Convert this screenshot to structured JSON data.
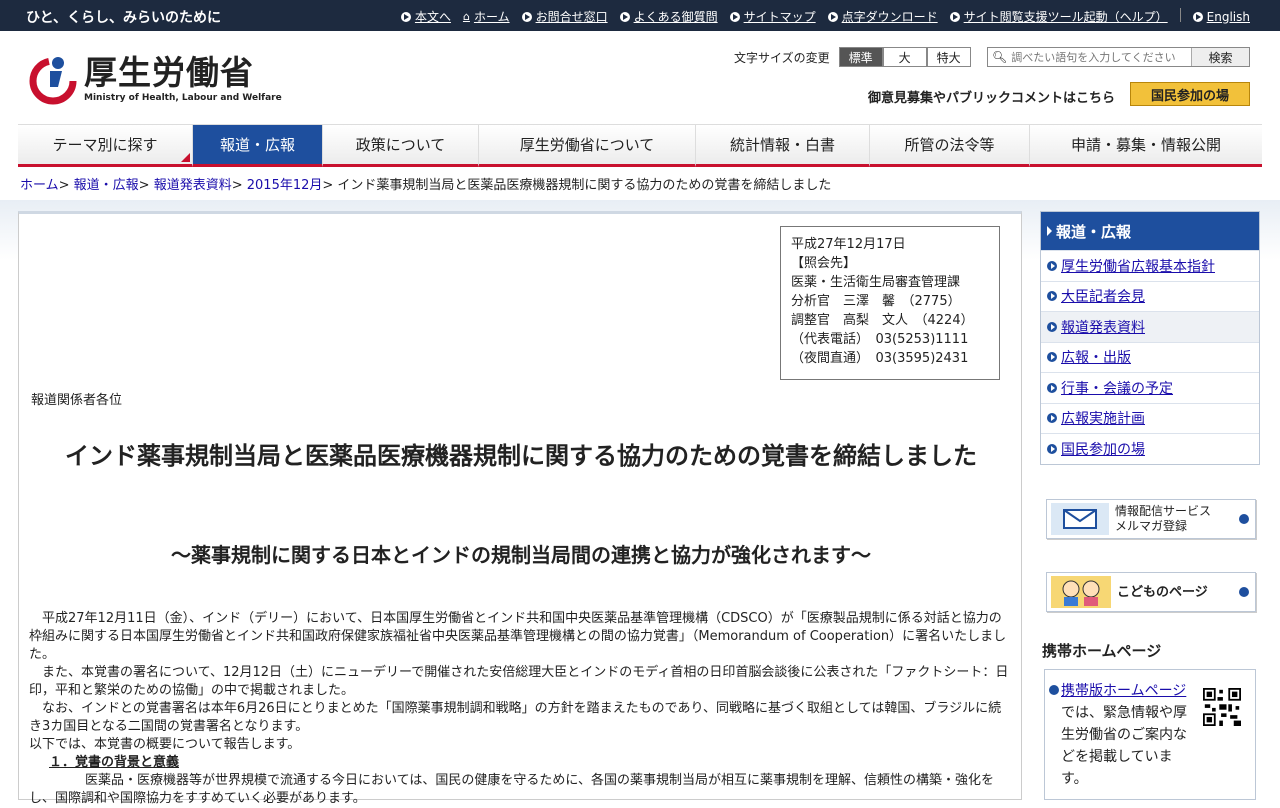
{
  "topbar": {
    "slogan": "ひと、くらし、みらいのために",
    "links": [
      "本文へ",
      "ホーム",
      "お問合せ窓口",
      "よくある御質問",
      "サイトマップ",
      "点字ダウンロード",
      "サイト閲覧支援ツール起動（ヘルプ）"
    ],
    "english": "English"
  },
  "header": {
    "logo_jp": "厚生労働省",
    "logo_en": "Ministry of Health, Labour and Welfare",
    "fontsize_label": "文字サイズの変更",
    "fontsize_options": [
      "標準",
      "大",
      "特大"
    ],
    "search_placeholder": "調べたい語句を入力してください",
    "search_button": "検索",
    "public_text": "御意見募集やパブリックコメントはこちら",
    "public_button": "国民参加の場"
  },
  "gnav": [
    "テーマ別に探す",
    "報道・広報",
    "政策について",
    "厚生労働省について",
    "統計情報・白書",
    "所管の法令等",
    "申請・募集・情報公開"
  ],
  "breadcrumb": {
    "links": [
      "ホーム",
      "報道・広報",
      "報道発表資料",
      "2015年12月"
    ],
    "current": "インド薬事規制当局と医薬品医療機器規制に関する協力のための覚書を締結しました"
  },
  "contact": "平成27年12月17日\n【照会先】\n医薬・生活衛生局審査管理課\n分析官　三澤　馨　（2775）\n調整官　高梨　文人　（4224）\n（代表電話）　03(5253)1111\n（夜間直通）　03(3595)2431",
  "article": {
    "addressee": "報道関係者各位",
    "title": "インド薬事規制当局と医薬品医療機器規制に関する協力のための覚書を締結しました",
    "subtitle": "～薬事規制に関する日本とインドの規制当局間の連携と協力が強化されます～",
    "p1": "　平成27年12月11日（金）、インド（デリー）において、日本国厚生労働省とインド共和国中央医薬品基準管理機構（CDSCO）が「医療製品規制に係る対話と協力の枠組みに関する日本国厚生労働省とインド共和国政府保健家族福祉省中央医薬品基準管理機構との間の協力覚書」（Memorandum of Cooperation）に署名いたしました。",
    "p2": "　また、本覚書の署名について、12月12日（土）にニューデリーで開催された安倍総理大臣とインドのモディ首相の日印首脳会談後に公表された「ファクトシート：日印，平和と繁栄のための協働」の中で掲載されました。",
    "p3": "　なお、インドとの覚書署名は本年6月26日にとりまとめた「国際薬事規制調和戦略」の方針を踏まえたものであり、同戦略に基づく取組としては韓国、ブラジルに続き3カ国目となる二国間の覚書署名となります。",
    "p4": "以下では、本覚書の概要について報告します。",
    "h1": "１．覚書の背景と意義",
    "p5": "医薬品・医療機器等が世界規模で流通する今日においては、国民の健康を守るために、各国の薬事規制当局が相互に薬事規制を理解、信頼性の構築・強化をし、国際調和や国際協力をすすめていく必要があります。"
  },
  "sidebar": {
    "head": "報道・広報",
    "items": [
      "厚生労働省広報基本指針",
      "大臣記者会見",
      "報道発表資料",
      "広報・出版",
      "行事・会議の予定",
      "広報実施計画",
      "国民参加の場"
    ],
    "mail_banner": "情報配信サービス\nメルマガ登録",
    "kids_banner": "こどものページ",
    "mobile_title": "携帯ホームページ",
    "mobile_link": "携帯版ホームページ",
    "mobile_text": "では、緊急情報や厚生労働省のご案内などを掲載しています。"
  },
  "colors": {
    "topbar": "#1d2a3f",
    "nav_active": "#1e4f9e",
    "accent_red": "#c8102e",
    "public_btn": "#f2c13a"
  }
}
